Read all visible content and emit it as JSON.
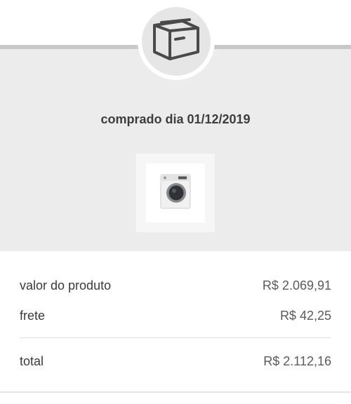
{
  "order": {
    "purchase_text": "comprado dia 01/12/2019",
    "status_icon": "box-icon",
    "product_image": "washing-machine-thumbnail"
  },
  "summary": {
    "rows": [
      {
        "label": "valor do produto",
        "value": "R$ 2.069,91"
      },
      {
        "label": "frete",
        "value": "R$ 42,25"
      }
    ],
    "total": {
      "label": "total",
      "value": "R$ 2.112,16"
    }
  },
  "colors": {
    "panel_bg": "#ececec",
    "accent_line": "#c9c9c9",
    "text_dark": "#3d3d3d"
  }
}
